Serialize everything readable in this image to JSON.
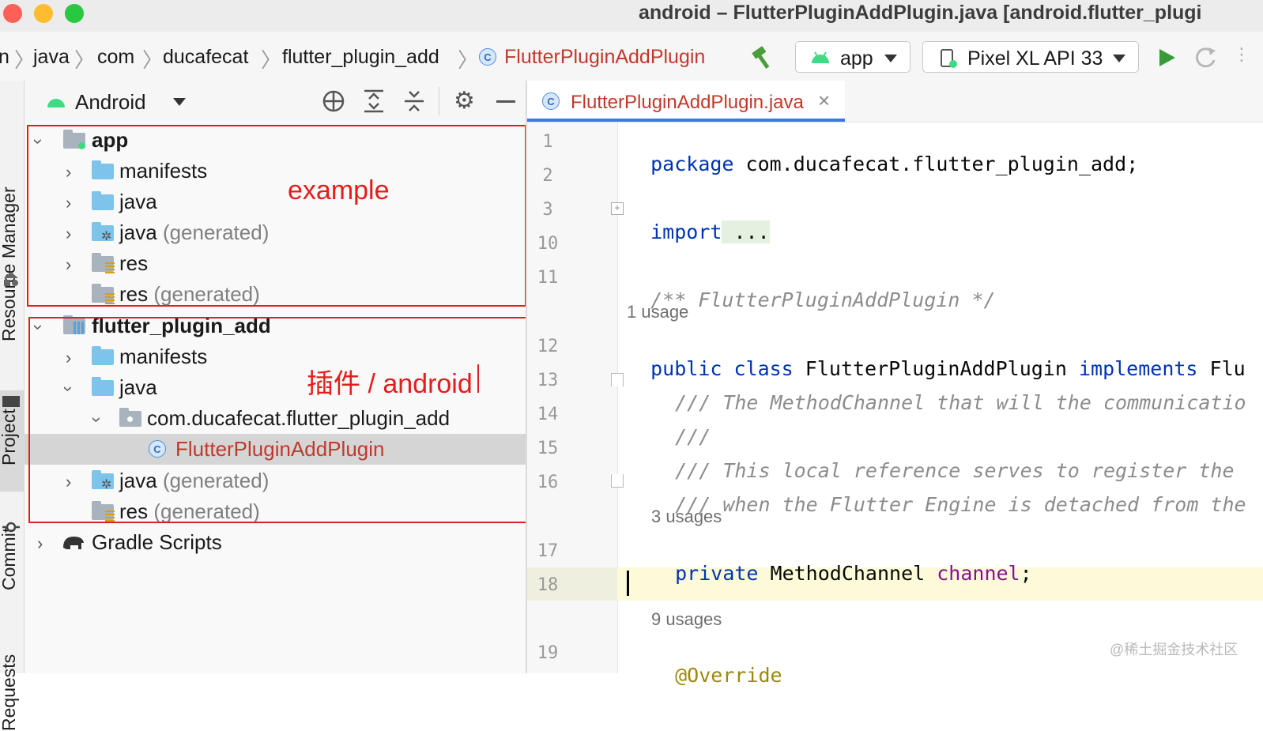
{
  "window": {
    "title": "android – FlutterPluginAddPlugin.java [android.flutter_plugi",
    "traffic_lights": {
      "close": "#fe5f57",
      "minimize": "#febc2e",
      "zoom": "#28c840"
    }
  },
  "breadcrumb": {
    "items": [
      "n",
      "java",
      "com",
      "ducafecat",
      "flutter_plugin_add"
    ],
    "current": "FlutterPluginAddPlugin",
    "class_badge": "C"
  },
  "toolbar": {
    "build_icon": "hammer-icon",
    "run_config": "app",
    "device": "Pixel XL API 33",
    "run_icon": "play-icon",
    "rerun_icon": "rerun-icon"
  },
  "side_tabs": [
    "Resource Manager",
    "Project",
    "Commit",
    "Requests"
  ],
  "project_panel": {
    "view": "Android",
    "tree": [
      {
        "label": "app",
        "bold": true,
        "expanded": true
      },
      {
        "label": "manifests"
      },
      {
        "label": "java"
      },
      {
        "label": "java",
        "suffix": "(generated)"
      },
      {
        "label": "res"
      },
      {
        "label": "res",
        "suffix": "(generated)"
      },
      {
        "label": "flutter_plugin_add",
        "bold": true,
        "expanded": true
      },
      {
        "label": "manifests"
      },
      {
        "label": "java",
        "expanded": true
      },
      {
        "label": "com.ducafecat.flutter_plugin_add",
        "expanded": true
      },
      {
        "label": "FlutterPluginAddPlugin",
        "selected": true
      },
      {
        "label": "java",
        "suffix": "(generated)"
      },
      {
        "label": "res",
        "suffix": "(generated)"
      },
      {
        "label": "Gradle Scripts"
      }
    ],
    "annotations": {
      "example": "example",
      "plugin": "插件 / android"
    }
  },
  "editor": {
    "tab_label": "FlutterPluginAddPlugin.java",
    "tab_close": "×",
    "lines": [
      {
        "n": "1",
        "tokens": [
          {
            "t": "package",
            "c": "kw"
          },
          {
            "t": " com.ducafecat.flutter_plugin_add;"
          }
        ]
      },
      {
        "n": "2",
        "tokens": []
      },
      {
        "n": "3",
        "tokens": [
          {
            "t": "import",
            "c": "kw"
          },
          {
            "t": " ..."
          }
        ]
      },
      {
        "n": "10",
        "tokens": []
      },
      {
        "n": "11",
        "tokens": [
          {
            "t": "/** FlutterPluginAddPlugin */",
            "c": "cm"
          }
        ]
      },
      {
        "n": "12",
        "tokens": [
          {
            "t": "public class",
            "c": "kw"
          },
          {
            "t": " FlutterPluginAddPlugin "
          },
          {
            "t": "implements",
            "c": "kw"
          },
          {
            "t": " Flu"
          }
        ]
      },
      {
        "n": "13",
        "tokens": [
          {
            "t": "/// The MethodChannel that will the communicatio",
            "c": "cm"
          }
        ]
      },
      {
        "n": "14",
        "tokens": [
          {
            "t": "///",
            "c": "cm"
          }
        ]
      },
      {
        "n": "15",
        "tokens": [
          {
            "t": "/// This local reference serves to register the",
            "c": "cm"
          }
        ]
      },
      {
        "n": "16",
        "tokens": [
          {
            "t": "/// when the Flutter Engine is detached from the",
            "c": "cm"
          }
        ]
      },
      {
        "n": "17",
        "tokens": [
          {
            "t": "private",
            "c": "kw"
          },
          {
            "t": " MethodChannel "
          },
          {
            "t": "channel",
            "c": "fld"
          },
          {
            "t": ";"
          }
        ]
      },
      {
        "n": "18",
        "tokens": []
      },
      {
        "n": "19",
        "tokens": [
          {
            "t": "@Override",
            "c": "ann"
          }
        ]
      }
    ],
    "usages": [
      "1 usage",
      "3 usages",
      "9 usages"
    ]
  },
  "watermark": "@稀土掘金技术社区"
}
